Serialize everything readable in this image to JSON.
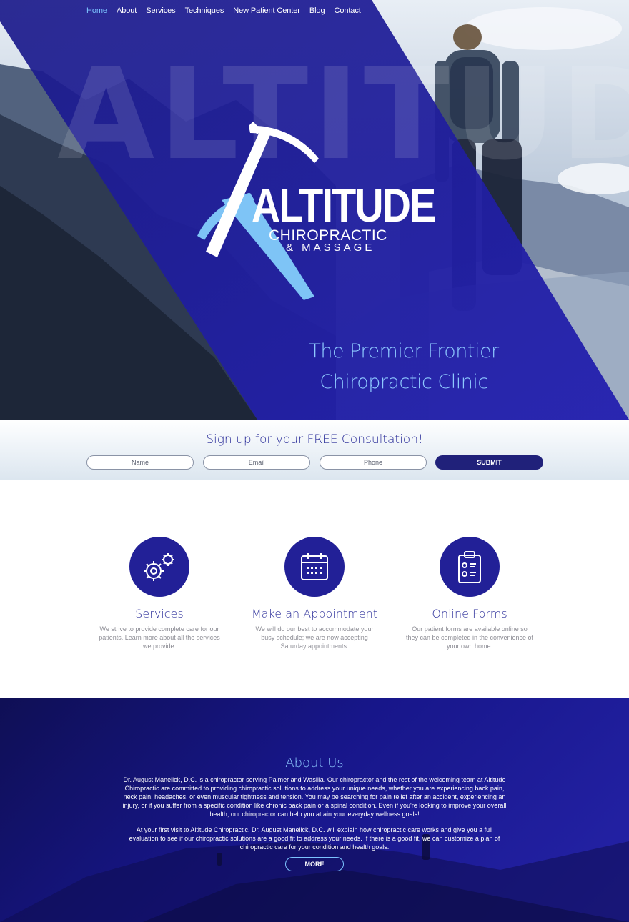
{
  "nav": {
    "items": [
      "Home",
      "About",
      "Services",
      "Techniques",
      "New Patient Center",
      "Blog",
      "Contact"
    ],
    "active_index": 0
  },
  "hero": {
    "watermark": "ALTITUDE",
    "logo": {
      "wordmark": "ALTITUDE",
      "line1": "CHIROPRACTIC",
      "line2": "& MASSAGE"
    },
    "tagline_line1": "The Premier Frontier",
    "tagline_line2": "Chiropractic Clinic"
  },
  "signup": {
    "title": "Sign up for your FREE Consultation!",
    "name_placeholder": "Name",
    "email_placeholder": "Email",
    "phone_placeholder": "Phone",
    "submit_label": "SUBMIT"
  },
  "features": [
    {
      "icon": "gears-icon",
      "title": "Services",
      "description": "We strive to provide complete care for our patients. Learn more about all the services we provide."
    },
    {
      "icon": "calendar-icon",
      "title": "Make an Appointment",
      "description": "We will do our best to accommodate your busy schedule; we are now accepting Saturday appointments."
    },
    {
      "icon": "clipboard-icon",
      "title": "Online Forms",
      "description": "Our patient forms are available online so they can be completed in the convenience of your own home."
    }
  ],
  "about": {
    "title": "About Us",
    "paragraph1": "Dr. August Manelick, D.C. is a chiropractor serving Palmer and Wasilla. Our chiropractor and the rest of the welcoming team at Altitude Chiropractic are committed to providing chiropractic solutions to address your unique needs, whether you are experiencing back pain, neck pain, headaches, or even muscular tightness and tension. You may be searching for pain relief after an accident, experiencing an injury, or if you suffer from a specific condition like chronic back pain or a spinal condition. Even if you're looking to improve your overall health, our chiropractor can help you attain your everyday wellness goals!",
    "paragraph2": "At your first visit to Altitude Chiropractic, Dr. August Manelick, D.C. will explain how chiropractic care works and give you a full evaluation to see if our chiropractic solutions are a good fit to address your needs. If there is a good fit, we can customize a plan of chiropractic care for your condition and health goals.",
    "more_label": "MORE"
  },
  "colors": {
    "brand_blue": "#1d1b96",
    "accent_light_blue": "#8ec9ff",
    "nav_active": "#7cc3ff"
  }
}
